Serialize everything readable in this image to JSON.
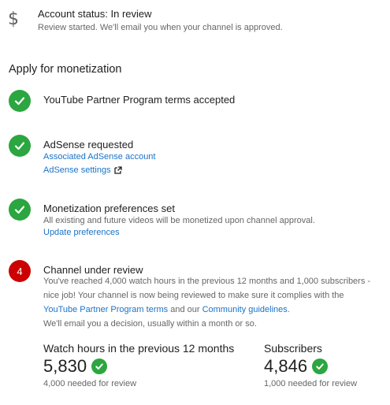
{
  "account_status": {
    "icon": "dollar-icon",
    "title": "Account status: In review",
    "subtitle": "Review started. We'll email you when your channel is approved."
  },
  "section": {
    "title": "Apply for monetization"
  },
  "steps": [
    {
      "status": "complete",
      "icon": "check-icon",
      "title": "YouTube Partner Program terms accepted"
    },
    {
      "status": "complete",
      "icon": "check-icon",
      "title": "AdSense requested",
      "links": [
        "Associated AdSense account",
        "AdSense settings"
      ],
      "external_icon": "external-link-icon"
    },
    {
      "status": "complete",
      "icon": "check-icon",
      "title": "Monetization preferences set",
      "text": "All existing and future videos will be monetized upon channel approval.",
      "link": "Update preferences"
    },
    {
      "status": "in_progress",
      "number": "4",
      "title": "Channel under review",
      "text_part1": "You've reached 4,000 watch hours in the previous 12 months and 1,000 subscribers - nice job! Your channel is now being reviewed to make sure it complies with the ",
      "link1": "YouTube Partner Program terms",
      "text_part2": " and our ",
      "link2": "Community guidelines",
      "text_part3": ".",
      "text_part4": "We'll email you a decision, usually within a month or so."
    }
  ],
  "metrics": [
    {
      "label": "Watch hours in the previous 12 months",
      "value": "5,830",
      "note": "4,000 needed for review"
    },
    {
      "label": "Subscribers",
      "value": "4,846",
      "note": "1,000 needed for review"
    }
  ],
  "colors": {
    "success": "#2ba640",
    "alert": "#cc0000",
    "link": "#1a73c8"
  }
}
